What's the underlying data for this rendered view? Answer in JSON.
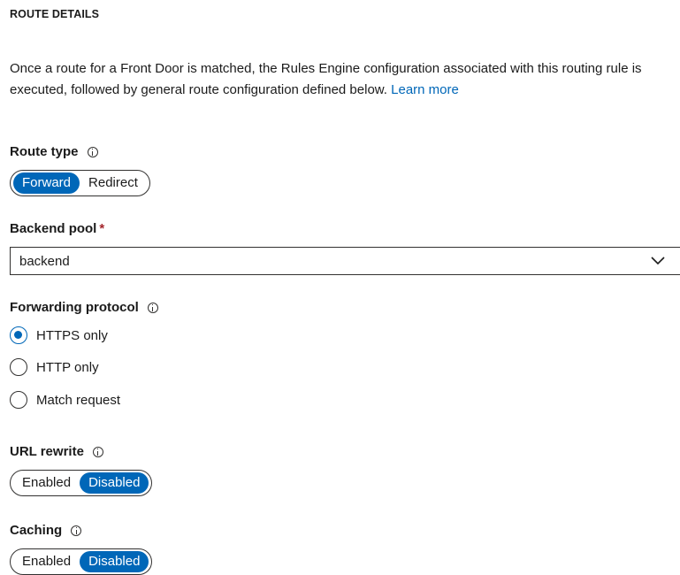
{
  "section": {
    "title": "ROUTE DETAILS"
  },
  "description": {
    "text": "Once a route for a Front Door is matched, the Rules Engine configuration associated with this routing rule is executed, followed by general route configuration defined below.",
    "link_text": "Learn more"
  },
  "route_type": {
    "label": "Route type",
    "options": [
      "Forward",
      "Redirect"
    ],
    "selected": "Forward"
  },
  "backend_pool": {
    "label": "Backend pool",
    "required_marker": "*",
    "value": "backend"
  },
  "forwarding_protocol": {
    "label": "Forwarding protocol",
    "options": [
      "HTTPS only",
      "HTTP only",
      "Match request"
    ],
    "selected": "HTTPS only"
  },
  "url_rewrite": {
    "label": "URL rewrite",
    "options": [
      "Enabled",
      "Disabled"
    ],
    "selected": "Disabled"
  },
  "caching": {
    "label": "Caching",
    "options": [
      "Enabled",
      "Disabled"
    ],
    "selected": "Disabled"
  },
  "colors": {
    "accent": "#0067b8",
    "required": "#a4262c",
    "border": "#323130"
  }
}
